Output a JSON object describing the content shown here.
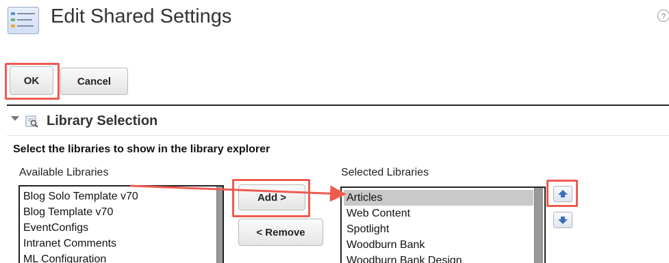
{
  "header": {
    "title": "Edit Shared Settings",
    "help_icon": "question-circle-icon",
    "help_glyph": "?"
  },
  "toolbar": {
    "ok_label": "OK",
    "cancel_label": "Cancel"
  },
  "section": {
    "title": "Library Selection",
    "collapsed": false
  },
  "instructions": "Select the libraries to show in the library explorer",
  "available": {
    "label": "Available Libraries",
    "items": [
      "Blog Solo Template v70",
      "Blog Template v70",
      "EventConfigs",
      "Intranet Comments",
      "ML Configuration"
    ]
  },
  "selected": {
    "label": "Selected Libraries",
    "items": [
      "Articles",
      "Web Content",
      "Spotlight",
      "Woodburn Bank",
      "Woodburn Bank Design"
    ],
    "selected_item": "Articles"
  },
  "actions": {
    "add_label": "Add >",
    "remove_label": "< Remove"
  },
  "order": {
    "up_icon": "arrow-up-icon",
    "down_icon": "arrow-down-icon"
  },
  "colors": {
    "highlight": "#ef5a4f",
    "order_arrow": "#3a6fb7",
    "selection": "#c9c9c9"
  }
}
